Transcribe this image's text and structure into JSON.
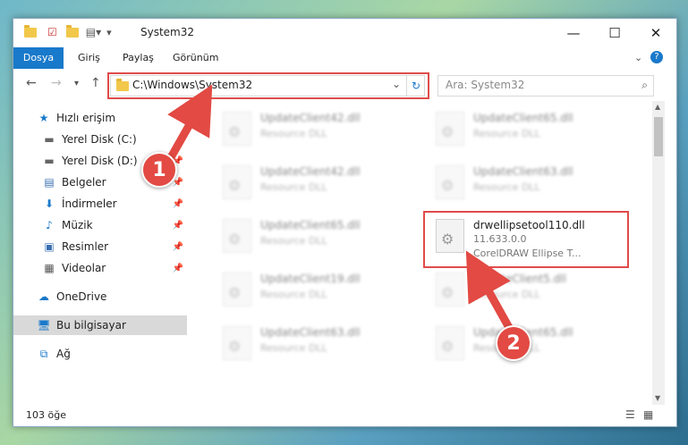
{
  "window": {
    "title": "System32",
    "controls": {
      "minimize": "—",
      "maximize": "☐",
      "close": "✕"
    }
  },
  "ribbon": {
    "tabs": [
      "Dosya",
      "Giriş",
      "Paylaş",
      "Görünüm"
    ]
  },
  "address": {
    "path": "C:\\Windows\\System32",
    "search_placeholder": "Ara: System32"
  },
  "sidebar": {
    "items": [
      {
        "label": "Hızlı erişim"
      },
      {
        "label": "Yerel Disk (C:)"
      },
      {
        "label": "Yerel Disk (D:)"
      },
      {
        "label": "Belgeler"
      },
      {
        "label": "İndirmeler"
      },
      {
        "label": "Müzik"
      },
      {
        "label": "Resimler"
      },
      {
        "label": "Videolar"
      },
      {
        "label": "OneDrive"
      },
      {
        "label": "Bu bilgisayar"
      },
      {
        "label": "Ağ"
      }
    ]
  },
  "files": {
    "blurred": [
      {
        "name": "UpdateClient42.dll",
        "desc": "Resource DLL"
      },
      {
        "name": "UpdateClient65.dll",
        "desc": "Resource DLL"
      },
      {
        "name": "UpdateClient42.dll",
        "desc": "Resource DLL"
      },
      {
        "name": "UpdateClient63.dll",
        "desc": "Resource DLL"
      },
      {
        "name": "UpdateClient65.dll",
        "desc": "Resource DLL"
      },
      {
        "name": "UpdateClient19.dll",
        "desc": "Resource DLL"
      },
      {
        "name": "UpdateClient5.dll",
        "desc": "Resource DLL"
      },
      {
        "name": "UpdateClient63.dll",
        "desc": "Resource DLL"
      },
      {
        "name": "UpdateClient65.dll",
        "desc": "Resource DLL"
      }
    ],
    "target": {
      "name": "drwellipsetool110.dll",
      "version": "11.633.0.0",
      "desc": "CorelDRAW Ellipse T..."
    }
  },
  "status": {
    "count": "103 öğe"
  },
  "badges": {
    "one": "1",
    "two": "2"
  },
  "colors": {
    "accent": "#1979ca",
    "highlight": "#e04b4b"
  }
}
